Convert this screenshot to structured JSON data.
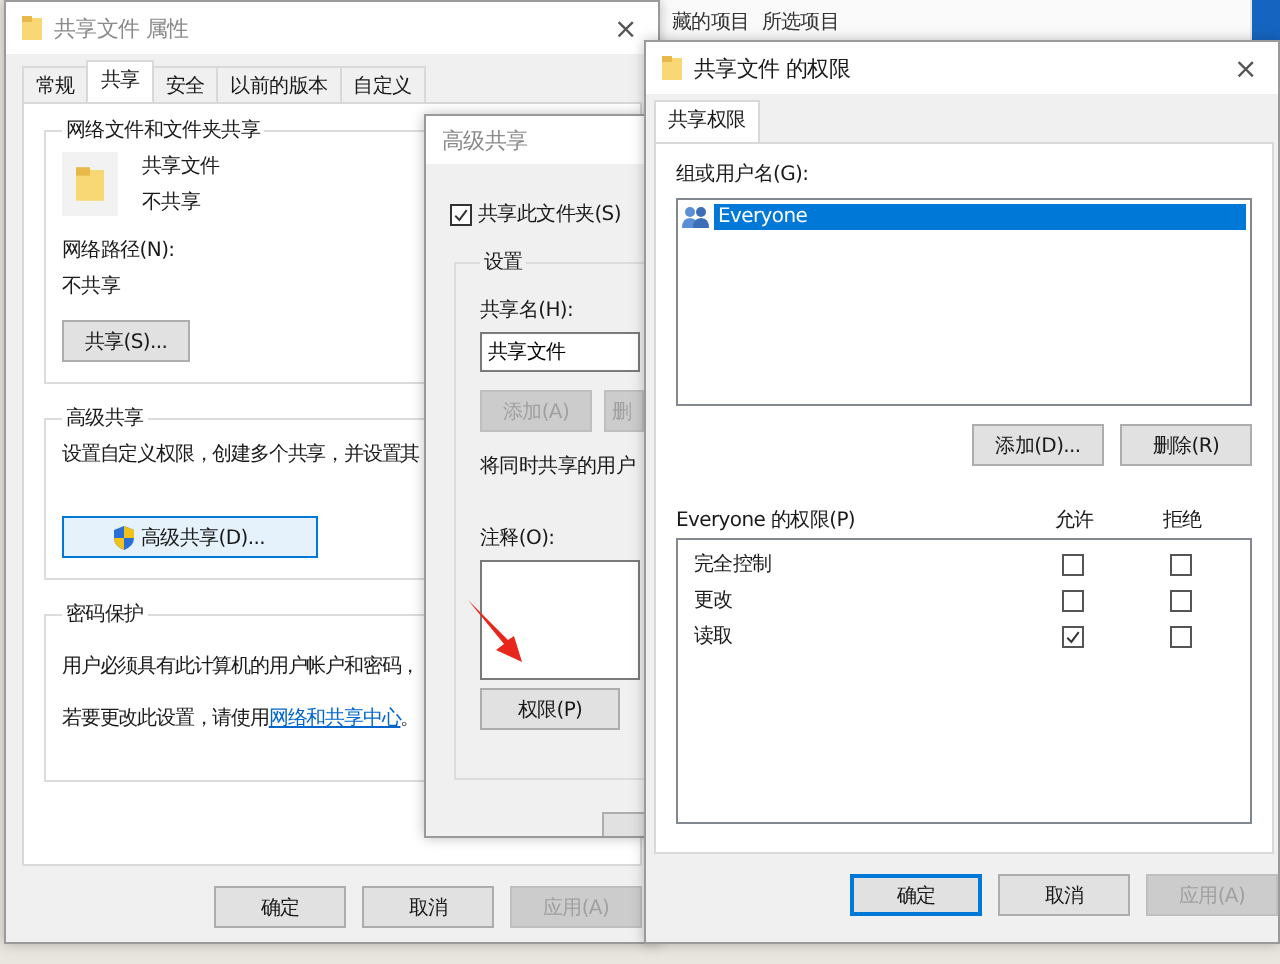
{
  "background": {
    "texts": [
      "藏的项目",
      "所选项目"
    ]
  },
  "properties_window": {
    "title": "共享文件 属性",
    "close": "×",
    "tabs": [
      {
        "label": "常规",
        "selected": false
      },
      {
        "label": "共享",
        "selected": true
      },
      {
        "label": "安全",
        "selected": false
      },
      {
        "label": "以前的版本",
        "selected": false
      },
      {
        "label": "自定义",
        "selected": false
      }
    ],
    "network_group": {
      "title": "网络文件和文件夹共享",
      "name": "共享文件",
      "status": "不共享",
      "path_label": "网络路径(N):",
      "path": "不共享",
      "share_button": "共享(S)..."
    },
    "advanced_group": {
      "title": "高级共享",
      "description": "设置自定义权限，创建多个共享，并设置其",
      "button": "高级共享(D)..."
    },
    "password_group": {
      "title": "密码保护",
      "line_1": "用户必须具有此计算机的用户帐户和密码，",
      "line_2_prefix": "若要更改此设置，请使用",
      "link": "网络和共享中心",
      "line_2_suffix": "。"
    },
    "buttons": [
      {
        "label": "确定",
        "disabled": false
      },
      {
        "label": "取消",
        "disabled": false
      },
      {
        "label": "应用(A)",
        "disabled": true
      }
    ]
  },
  "advanced_window": {
    "title": "高级共享",
    "share_checkbox": {
      "label": "共享此文件夹(S)",
      "checked": true
    },
    "settings_group": {
      "title": "设置",
      "share_name_label": "共享名(H):",
      "share_name": "共享文件",
      "buttons": [
        {
          "label": "添加(A)",
          "disabled": true
        },
        {
          "label": "删",
          "disabled": true
        }
      ],
      "user_limit_label": "将同时共享的用户",
      "comment_label": "注释(O):",
      "permissions_button": "权限(P)"
    }
  },
  "permissions_window": {
    "title": "共享文件 的权限",
    "close": "×",
    "tabs": [
      {
        "label": "共享权限",
        "selected": true
      }
    ],
    "users_label": "组或用户名(G):",
    "users": [
      {
        "name": "Everyone",
        "selected": true
      }
    ],
    "user_buttons": [
      "添加(D)...",
      "删除(R)"
    ],
    "permissions_label": "Everyone 的权限(P)",
    "columns": [
      "允许",
      "拒绝"
    ],
    "permissions": [
      {
        "name": "完全控制",
        "allow": false,
        "deny": false
      },
      {
        "name": "更改",
        "allow": false,
        "deny": false
      },
      {
        "name": "读取",
        "allow": true,
        "deny": false
      }
    ],
    "buttons": [
      {
        "label": "确定",
        "default": true,
        "disabled": false
      },
      {
        "label": "取消",
        "default": false,
        "disabled": false
      },
      {
        "label": "应用(A)",
        "default": false,
        "disabled": true
      }
    ]
  }
}
